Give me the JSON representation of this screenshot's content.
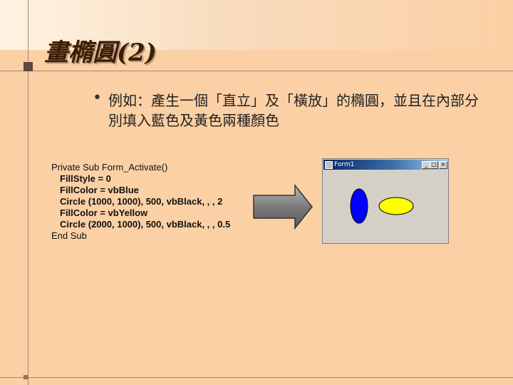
{
  "slide": {
    "title": "畫橢圓(2)",
    "bullet": "例如：產生一個「直立」及「橫放」的橢圓，並且在內部分別填入藍色及黃色兩種顏色"
  },
  "code_lines": [
    "Private Sub Form_Activate()",
    "FillStyle = 0",
    "FillColor = vbBlue",
    "Circle (1000, 1000), 500, vbBlack, , , 2",
    "FillColor = vbYellow",
    "Circle (2000, 1000), 500, vbBlack, , , 0.5",
    "End Sub"
  ],
  "window": {
    "title": "Form1",
    "buttons": {
      "minimize": "_",
      "maximize": "□",
      "close": "×"
    }
  },
  "colors": {
    "background": "#fbd0a4",
    "title": "#3a1e05",
    "blue_ellipse": "#0000ff",
    "yellow_ellipse": "#ffff00"
  },
  "icons": [
    "bullet-dot",
    "right-arrow-icon",
    "form-icon"
  ]
}
